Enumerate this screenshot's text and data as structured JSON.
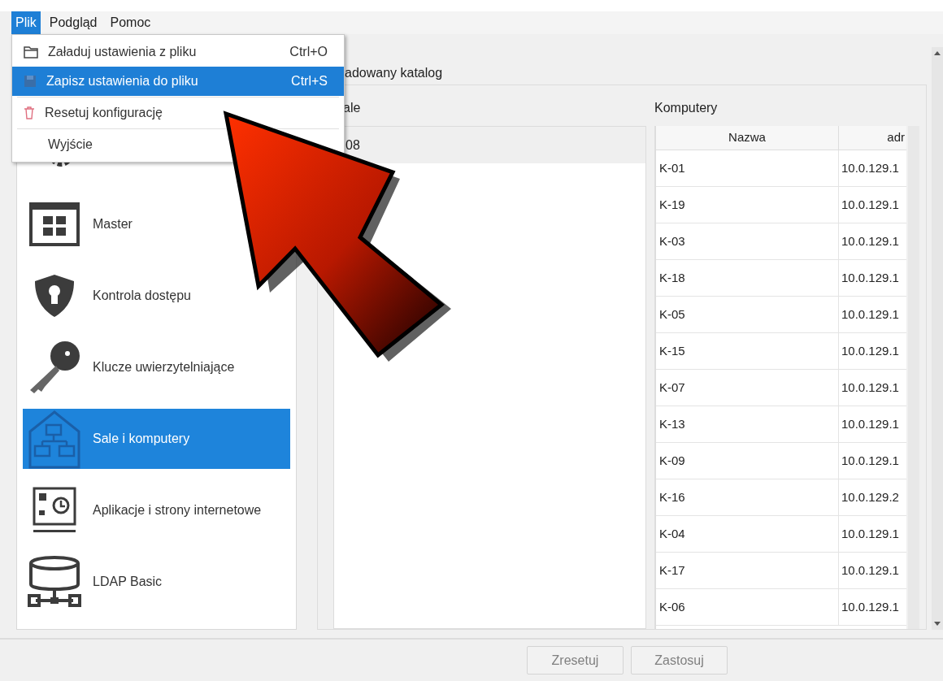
{
  "menu_bar": [
    {
      "label": "Plik",
      "selected": true
    },
    {
      "label": "Podgląd",
      "selected": false
    },
    {
      "label": "Pomoc",
      "selected": false
    }
  ],
  "file_menu": [
    {
      "kind": "open",
      "label": "Załaduj ustawienia z pliku",
      "shortcut": "Ctrl+O",
      "selected": false
    },
    {
      "kind": "save",
      "label": "Zapisz ustawienia do pliku",
      "shortcut": "Ctrl+S",
      "selected": true
    },
    {
      "kind": "reset",
      "label": "Resetuj konfigurację",
      "selected": false
    },
    {
      "kind": "exit",
      "label": "Wyjście",
      "selected": false
    }
  ],
  "sidebar": {
    "items": [
      {
        "kind": "gear",
        "selected": false
      },
      {
        "kind": "grid",
        "label": "Master",
        "selected": false
      },
      {
        "kind": "shield",
        "label": "Kontrola dostępu",
        "selected": false
      },
      {
        "kind": "key",
        "label": "Klucze uwierzytelniające",
        "selected": false
      },
      {
        "kind": "rooms",
        "label": "Sale i komputery",
        "selected": true
      },
      {
        "kind": "apps",
        "label": "Aplikacje i strony internetowe",
        "selected": false
      },
      {
        "kind": "ldap",
        "label": "LDAP Basic",
        "selected": false
      }
    ]
  },
  "section_title": "adowany katalog",
  "rooms": {
    "label": "ale",
    "items": [
      {
        "label": "08",
        "selected": true
      }
    ]
  },
  "computers": {
    "label": "Komputery",
    "columns": [
      "Nazwa",
      "adr"
    ],
    "rows": [
      [
        "K-01",
        "10.0.129.1"
      ],
      [
        "K-19",
        "10.0.129.1"
      ],
      [
        "K-03",
        "10.0.129.1"
      ],
      [
        "K-18",
        "10.0.129.1"
      ],
      [
        "K-05",
        "10.0.129.1"
      ],
      [
        "K-15",
        "10.0.129.1"
      ],
      [
        "K-07",
        "10.0.129.1"
      ],
      [
        "K-13",
        "10.0.129.1"
      ],
      [
        "K-09",
        "10.0.129.1"
      ],
      [
        "K-16",
        "10.0.129.2"
      ],
      [
        "K-04",
        "10.0.129.1"
      ],
      [
        "K-17",
        "10.0.129.1"
      ],
      [
        "K-06",
        "10.0.129.1"
      ]
    ]
  },
  "buttons": [
    {
      "label": "Zresetuj",
      "disabled": true
    },
    {
      "label": "Zastosuj",
      "disabled": true
    }
  ]
}
